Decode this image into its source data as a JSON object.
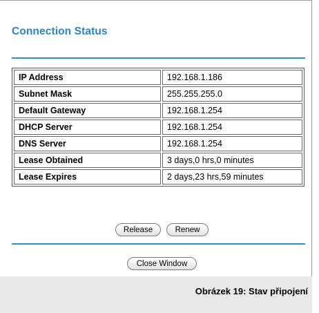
{
  "page": {
    "title": "Connection Status"
  },
  "status_table": {
    "rows": [
      {
        "label": "IP Address",
        "value": "192.168.1.186"
      },
      {
        "label": "Subnet Mask",
        "value": "255.255.255.0"
      },
      {
        "label": "Default Gateway",
        "value": "192.168.1.254"
      },
      {
        "label": "DHCP Server",
        "value": "192.168.1.254"
      },
      {
        "label": "DNS Server",
        "value": "192.168.1.254"
      },
      {
        "label": "Lease Obtained",
        "value": "3 days,0 hrs,0 minutes"
      },
      {
        "label": "Lease Expires",
        "value": "2 days,23 hrs,59 minutes"
      }
    ]
  },
  "buttons": {
    "release": "Release",
    "renew": "Renew",
    "close_window": "Close Window"
  },
  "caption": "Obrázek 19: Stav připojení",
  "colors": {
    "accent": "#2a84c7",
    "rule": "#2a8fd0",
    "caption_background": "#e9e9e9"
  }
}
